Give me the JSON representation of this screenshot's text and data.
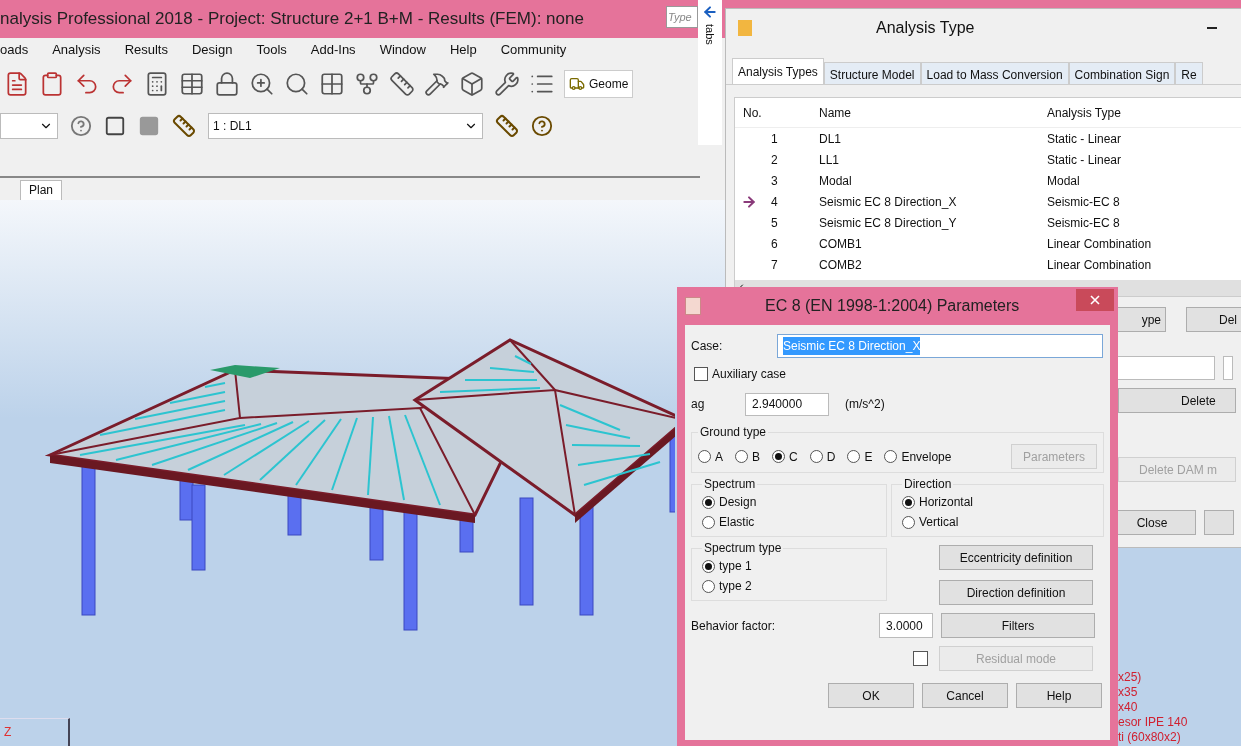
{
  "main_window": {
    "title": "nalysis Professional 2018 - Project: Structure 2+1 B+M - Results (FEM): none",
    "search_placeholder": "Type",
    "menu": [
      "oads",
      "Analysis",
      "Results",
      "Design",
      "Tools",
      "Add-Ins",
      "Window",
      "Help",
      "Community"
    ],
    "geometry_button": "Geome",
    "load_case": "1 : DL1",
    "view_tabs": [
      {
        "label": "Plan",
        "selected": true
      }
    ],
    "axis_label": "Z",
    "legend": [
      "x25)",
      "x35",
      "x40",
      "esor IPE 140",
      "ti (60x80x2)"
    ]
  },
  "side_tab": "tabs",
  "analysis_type_window": {
    "title": "Analysis Type",
    "tabs": [
      {
        "label": "Analysis Types",
        "selected": true
      },
      {
        "label": "Structure Model",
        "selected": false
      },
      {
        "label": "Load to Mass Conversion",
        "selected": false
      },
      {
        "label": "Combination Sign",
        "selected": false
      },
      {
        "label": "Re",
        "selected": false
      }
    ],
    "columns": [
      "No.",
      "Name",
      "Analysis Type"
    ],
    "rows": [
      {
        "no": "1",
        "name": "DL1",
        "type": "Static - Linear",
        "current": false
      },
      {
        "no": "2",
        "name": "LL1",
        "type": "Static - Linear",
        "current": false
      },
      {
        "no": "3",
        "name": "Modal",
        "type": "Modal",
        "current": false
      },
      {
        "no": "4",
        "name": "Seismic EC 8 Direction_X",
        "type": "Seismic-EC 8",
        "current": true
      },
      {
        "no": "5",
        "name": "Seismic EC 8 Direction_Y",
        "type": "Seismic-EC 8",
        "current": false
      },
      {
        "no": "6",
        "name": "COMB1",
        "type": "Linear Combination",
        "current": false
      },
      {
        "no": "7",
        "name": "COMB2",
        "type": "Linear Combination",
        "current": false
      }
    ],
    "buttons": [
      {
        "label": "ype",
        "disabled": false
      },
      {
        "label": "Del",
        "disabled": false
      },
      {
        "label": "Delete",
        "disabled": false
      },
      {
        "label": "Delete DAM m",
        "disabled": true
      },
      {
        "label": "Close",
        "disabled": false
      }
    ]
  },
  "ec8_dialog": {
    "title": "EC 8 (EN 1998-1:2004) Parameters",
    "case_label": "Case:",
    "case_value": "Seismic EC 8 Direction_X",
    "auxiliary": {
      "label": "Auxiliary case",
      "checked": false
    },
    "ag_label": "ag",
    "ag_value": "2.940000",
    "ag_unit": "(m/s^2)",
    "ground_type": {
      "label": "Ground type",
      "options": [
        {
          "label": "A",
          "selected": false
        },
        {
          "label": "B",
          "selected": false
        },
        {
          "label": "C",
          "selected": true
        },
        {
          "label": "D",
          "selected": false
        },
        {
          "label": "E",
          "selected": false
        },
        {
          "label": "Envelope",
          "selected": false
        }
      ],
      "button": {
        "label": "Parameters",
        "disabled": true
      }
    },
    "spectrum": {
      "label": "Spectrum",
      "options": [
        {
          "label": "Design",
          "selected": true
        },
        {
          "label": "Elastic",
          "selected": false
        }
      ]
    },
    "direction": {
      "label": "Direction",
      "options": [
        {
          "label": "Horizontal",
          "selected": true
        },
        {
          "label": "Vertical",
          "selected": false
        }
      ]
    },
    "spectrum_type": {
      "label": "Spectrum type",
      "options": [
        {
          "label": "type 1",
          "selected": true
        },
        {
          "label": "type 2",
          "selected": false
        }
      ]
    },
    "eccentricity_button": "Eccentricity definition",
    "direction_button": "Direction definition",
    "behavior_label": "Behavior factor:",
    "behavior_value": "3.0000",
    "filters_button": "Filters",
    "residual": {
      "label": "Residual mode",
      "checked": false,
      "disabled": true
    },
    "buttons": [
      "OK",
      "Cancel",
      "Help"
    ]
  }
}
